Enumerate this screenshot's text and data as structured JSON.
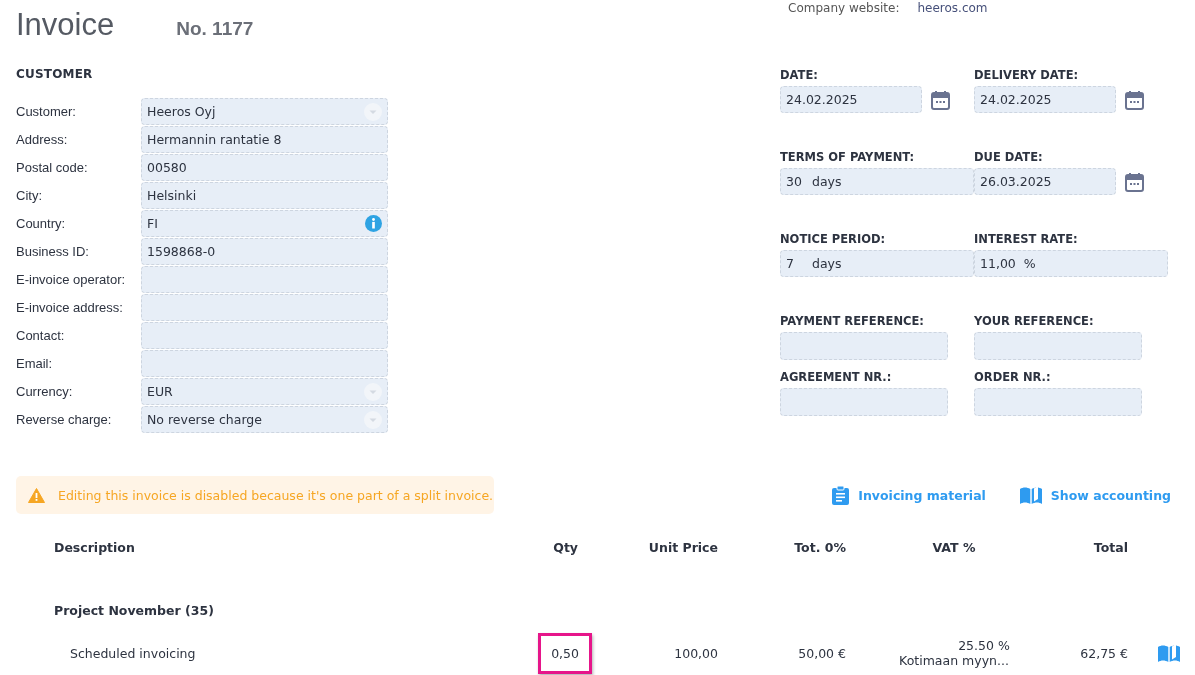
{
  "company_website": {
    "label": "Company website:",
    "value": "heeros.com"
  },
  "title": "Invoice",
  "number": "No. 1177",
  "customer": {
    "heading": "CUSTOMER",
    "fields": [
      {
        "label": "Customer:",
        "value": "Heeros Oyj",
        "kind": "dropdown"
      },
      {
        "label": "Address:",
        "value": "Hermannin rantatie 8",
        "kind": "text"
      },
      {
        "label": "Postal code:",
        "value": "00580",
        "kind": "text"
      },
      {
        "label": "City:",
        "value": "Helsinki",
        "kind": "text"
      },
      {
        "label": "Country:",
        "value": "FI",
        "kind": "info"
      },
      {
        "label": "Business ID:",
        "value": "1598868-0",
        "kind": "text"
      },
      {
        "label": "E-invoice operator:",
        "kind": "text"
      },
      {
        "label": "E-invoice address:",
        "kind": "text"
      },
      {
        "label": "Contact:",
        "kind": "text"
      },
      {
        "label": "Email:",
        "kind": "text"
      },
      {
        "label": "Currency:",
        "value": "EUR",
        "kind": "dropdown"
      },
      {
        "label": "Reverse charge:",
        "value": "No reverse charge",
        "kind": "dropdown"
      }
    ]
  },
  "details": [
    {
      "label": "DATE:",
      "value": "24.02.2025",
      "kind": "date"
    },
    {
      "label": "DELIVERY DATE:",
      "value": "24.02.2025",
      "kind": "date"
    },
    {
      "label": "TERMS OF PAYMENT:",
      "value": "30",
      "unit": "days",
      "kind": "unit"
    },
    {
      "label": "DUE DATE:",
      "value": "26.03.2025",
      "kind": "date"
    },
    {
      "label": "NOTICE PERIOD:",
      "value": "7",
      "unit": "days",
      "kind": "unit"
    },
    {
      "label": "INTEREST RATE:",
      "value": "11,00",
      "unit": "%",
      "kind": "unit"
    },
    {
      "label": "PAYMENT REFERENCE:",
      "kind": "text"
    },
    {
      "label": "YOUR REFERENCE:",
      "kind": "text"
    },
    {
      "label": "AGREEMENT NR.:",
      "kind": "text"
    },
    {
      "label": "ORDER NR.:",
      "kind": "text"
    }
  ],
  "notice": "Editing this invoice is disabled because it's one part of a split invoice.",
  "links": [
    {
      "label": "Invoicing material",
      "kind": "clipboard"
    },
    {
      "label": "Show accounting",
      "kind": "book"
    }
  ],
  "table": {
    "columns": [
      "Description",
      "Qty",
      "Unit Price",
      "Tot. 0%",
      "VAT %",
      "Total"
    ],
    "groups": [
      {
        "name": "Project November (35)",
        "rows": [
          {
            "description": "Scheduled invoicing",
            "qty": "0,50",
            "qty_highlighted": true,
            "unit_price": "100,00",
            "total_ex": "50,00 €",
            "vat": "25.50 %",
            "vat_name": "Kotimaan myyn...",
            "total": "62,75 €"
          }
        ]
      }
    ]
  }
}
